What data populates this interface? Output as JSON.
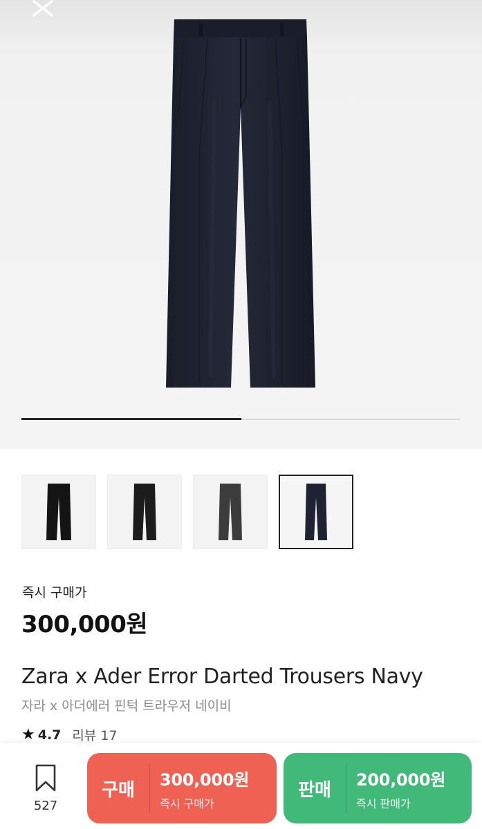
{
  "hero": {
    "close_icon": "close-icon",
    "image_progress": 0.5
  },
  "thumbnails": [
    {
      "label": "thumb-1",
      "color": "#141414"
    },
    {
      "label": "thumb-2",
      "color": "#1c1c1c"
    },
    {
      "label": "thumb-3",
      "color": "#3c3c3c"
    },
    {
      "label": "thumb-4",
      "color": "#1f2233"
    }
  ],
  "product": {
    "price_label": "즉시 구매가",
    "price": "300,000원",
    "title_en": "Zara x Ader Error Darted Trousers Navy",
    "title_ko": "자라 x 아더에러 핀턱 트라우저 네이비",
    "rating": "4.7",
    "reviews": "리뷰 17"
  },
  "bottom_bar": {
    "wish_icon": "bookmark-icon",
    "wish_count": "527",
    "buy": {
      "label": "구매",
      "price": "300,000원",
      "sub": "즉시 구매가",
      "color": "#ef6253"
    },
    "sell": {
      "label": "판매",
      "price": "200,000원",
      "sub": "즉시 판매가",
      "color": "#41b979"
    }
  }
}
